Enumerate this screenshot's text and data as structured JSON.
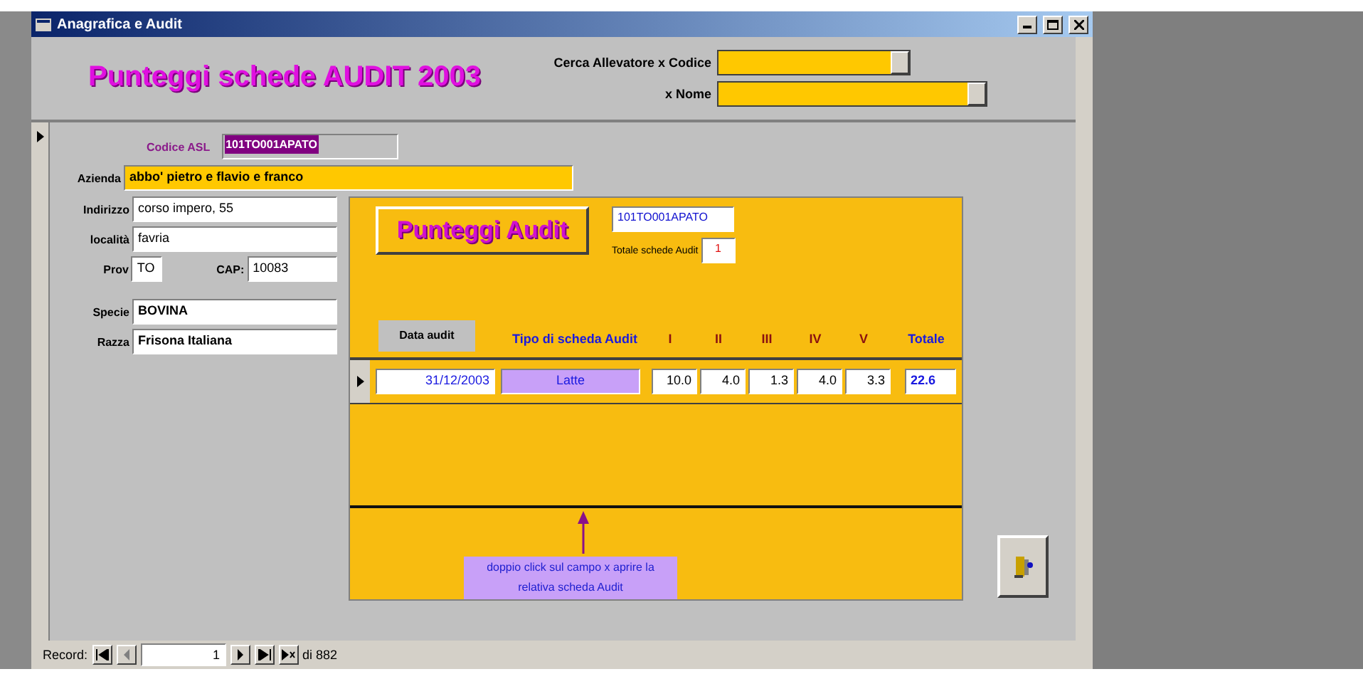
{
  "window": {
    "title": "Anagrafica e Audit"
  },
  "header": {
    "title": "Punteggi schede AUDIT 2003",
    "search_by_code": {
      "label": "Cerca Allevatore x Codice"
    },
    "search_by_name": {
      "label": "x Nome"
    }
  },
  "record": {
    "codice_asl": {
      "label": "Codice ASL",
      "value": "101TO001APATO"
    },
    "azienda": {
      "label": "Azienda",
      "value": "abbo' pietro e flavio e franco"
    },
    "fields": [
      {
        "label": "Indirizzo",
        "value": "corso impero, 55"
      },
      {
        "label": "località",
        "value": "favria"
      }
    ],
    "prov": {
      "label": "Prov",
      "value": "TO"
    },
    "cap": {
      "label": "CAP:",
      "value": "10083"
    },
    "fields2": [
      {
        "label": "Specie",
        "value": "BOVINA"
      },
      {
        "label": "Razza",
        "value": "Frisona Italiana"
      }
    ]
  },
  "subform": {
    "button": "Punteggi Audit",
    "code": "101TO001APATO",
    "total_label": "Totale schede Audit",
    "total_value": "1",
    "columns": [
      {
        "label": "Data audit",
        "kind": "button"
      },
      {
        "label": "Tipo di scheda Audit",
        "kind": "type"
      },
      {
        "label": "I",
        "kind": "score"
      },
      {
        "label": "II",
        "kind": "score"
      },
      {
        "label": "III",
        "kind": "score"
      },
      {
        "label": "IV",
        "kind": "score"
      },
      {
        "label": "V",
        "kind": "score"
      },
      {
        "label": "Totale",
        "kind": "total"
      }
    ],
    "rows": [
      {
        "date": "31/12/2003",
        "type": "Latte",
        "scores": [
          "10.0",
          "4.0",
          "1.3",
          "4.0",
          "3.3"
        ],
        "total": "22.6"
      }
    ],
    "note": "doppio click sul campo x aprire la relativa scheda Audit"
  },
  "navigation": {
    "label": "Record:",
    "current": "1",
    "count": "di 882"
  }
}
